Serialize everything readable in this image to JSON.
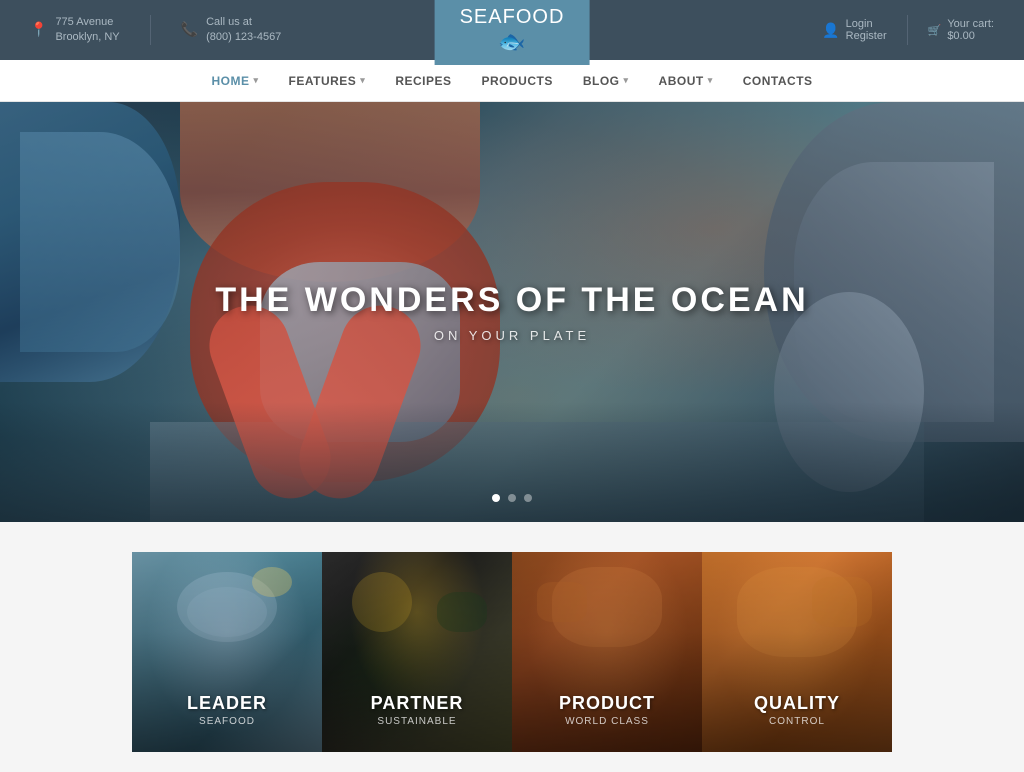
{
  "topbar": {
    "address_icon": "📍",
    "address_line1": "775 Avenue",
    "address_line2": "Brooklyn, NY",
    "phone_icon": "📞",
    "phone_label": "Call us at",
    "phone_number": "(800) 123-4567",
    "login_label": "Login",
    "register_label": "Register",
    "cart_label": "Your cart:",
    "cart_amount": "$0.00"
  },
  "logo": {
    "sea": "SEA",
    "food": "FOOD",
    "fish_icon": "🐟"
  },
  "nav": {
    "items": [
      {
        "label": "HOME",
        "active": true,
        "has_dropdown": true
      },
      {
        "label": "FEATURES",
        "active": false,
        "has_dropdown": true
      },
      {
        "label": "RECIPES",
        "active": false,
        "has_dropdown": false
      },
      {
        "label": "PRODUCTS",
        "active": false,
        "has_dropdown": false
      },
      {
        "label": "BLOG",
        "active": false,
        "has_dropdown": true
      },
      {
        "label": "ABOUT",
        "active": false,
        "has_dropdown": true
      },
      {
        "label": "CONTACTS",
        "active": false,
        "has_dropdown": false
      }
    ]
  },
  "hero": {
    "title": "THE WONDERS OF THE OCEAN",
    "subtitle": "ON YOUR PLATE",
    "dots": [
      {
        "active": true
      },
      {
        "active": false
      },
      {
        "active": false
      }
    ]
  },
  "cards": [
    {
      "title": "LEADER",
      "subtitle": "Seafood",
      "bg_class": "card-1-bg",
      "deco_class": "card-1-deco"
    },
    {
      "title": "PARTNER",
      "subtitle": "Sustainable",
      "bg_class": "card-2-bg",
      "deco_class": "card-2-deco"
    },
    {
      "title": "PRODUCT",
      "subtitle": "World Class",
      "bg_class": "card-3-bg",
      "deco_class": "card-3-deco"
    },
    {
      "title": "QUALITY",
      "subtitle": "Control",
      "bg_class": "card-4-bg",
      "deco_class": "card-4-deco"
    }
  ]
}
